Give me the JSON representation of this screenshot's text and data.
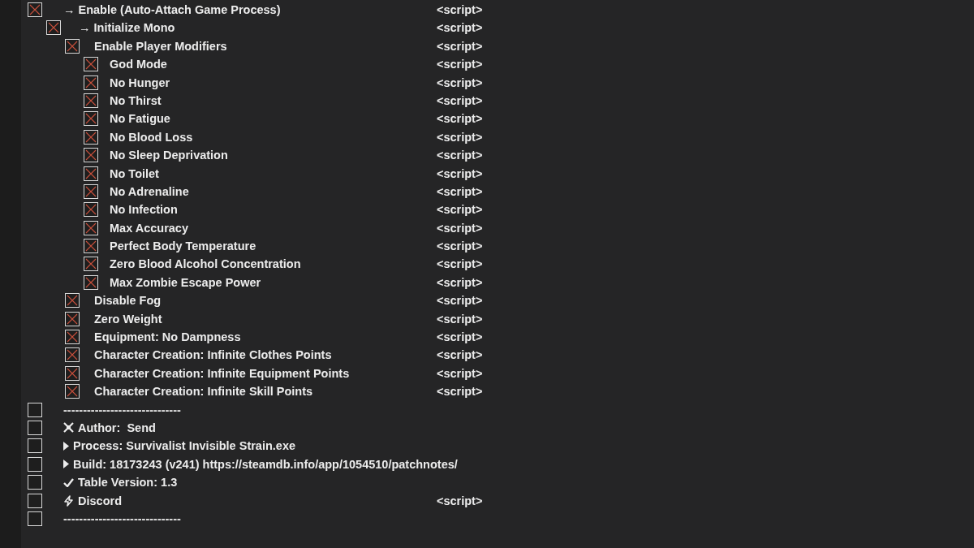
{
  "entries": [
    {
      "label": "→ Enable (Auto-Attach Game Process)",
      "checked": true,
      "value": "<script>",
      "children": [
        {
          "label": "→ Initialize Mono",
          "checked": true,
          "value": "<script>",
          "children": [
            {
              "label": "Enable Player Modifiers",
              "checked": true,
              "value": "<script>",
              "children": [
                {
                  "label": "God Mode",
                  "checked": true,
                  "value": "<script>"
                },
                {
                  "label": "No Hunger",
                  "checked": true,
                  "value": "<script>"
                },
                {
                  "label": "No Thirst",
                  "checked": true,
                  "value": "<script>"
                },
                {
                  "label": "No Fatigue",
                  "checked": true,
                  "value": "<script>"
                },
                {
                  "label": "No Blood Loss",
                  "checked": true,
                  "value": "<script>"
                },
                {
                  "label": "No Sleep Deprivation",
                  "checked": true,
                  "value": "<script>"
                },
                {
                  "label": "No Toilet",
                  "checked": true,
                  "value": "<script>"
                },
                {
                  "label": "No Adrenaline",
                  "checked": true,
                  "value": "<script>"
                },
                {
                  "label": "No Infection",
                  "checked": true,
                  "value": "<script>"
                },
                {
                  "label": "Max Accuracy",
                  "checked": true,
                  "value": "<script>"
                },
                {
                  "label": "Perfect Body Temperature",
                  "checked": true,
                  "value": "<script>"
                },
                {
                  "label": "Zero Blood Alcohol Concentration",
                  "checked": true,
                  "value": "<script>"
                },
                {
                  "label": "Max Zombie Escape Power",
                  "checked": true,
                  "value": "<script>"
                }
              ]
            },
            {
              "label": "Disable Fog",
              "checked": true,
              "value": "<script>"
            },
            {
              "label": "Zero Weight",
              "checked": true,
              "value": "<script>"
            },
            {
              "label": "Equipment: No Dampness",
              "checked": true,
              "value": "<script>"
            },
            {
              "label": "Character Creation: Infinite Clothes Points",
              "checked": true,
              "value": "<script>"
            },
            {
              "label": "Character Creation: Infinite Equipment Points",
              "checked": true,
              "value": "<script>"
            },
            {
              "label": "Character Creation: Infinite Skill Points",
              "checked": true,
              "value": "<script>"
            }
          ]
        }
      ]
    },
    {
      "label": "------------------------------",
      "checked": false
    },
    {
      "label": "Author:  Send",
      "checked": false,
      "kind": "crossbones"
    },
    {
      "label": "Process: Survivalist Invisible Strain.exe",
      "checked": false,
      "kind": "triangle"
    },
    {
      "label": "Build: 18173243 (v241) https://steamdb.info/app/1054510/patchnotes/",
      "checked": false,
      "kind": "triangle"
    },
    {
      "label": "Table Version: 1.3",
      "checked": false,
      "kind": "check"
    },
    {
      "label": "Discord",
      "checked": false,
      "value": "<script>",
      "kind": "bolt"
    },
    {
      "label": "------------------------------",
      "checked": false
    }
  ]
}
